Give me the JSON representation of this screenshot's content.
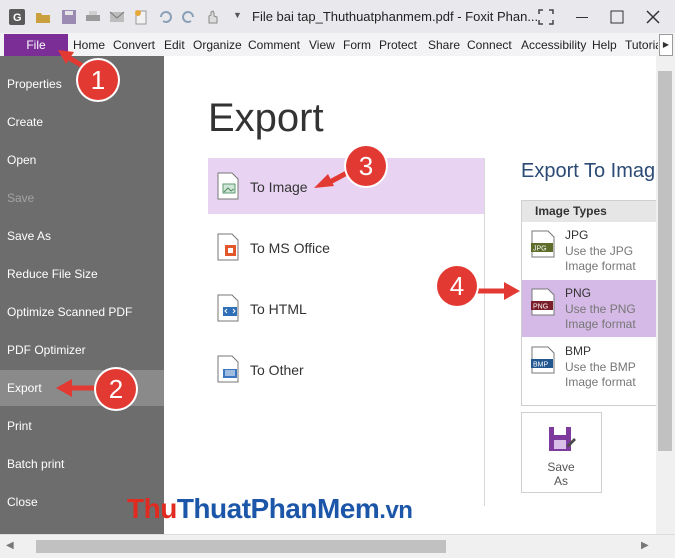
{
  "window": {
    "title": "File bai tap_Thuthuatphanmem.pdf - Foxit Phan..."
  },
  "ribbon": {
    "file_label": "File",
    "tabs": [
      "Home",
      "Convert",
      "Edit",
      "Organize",
      "Comment",
      "View",
      "Form",
      "Protect",
      "Share",
      "Connect",
      "Accessibility",
      "Help",
      "Tutoria"
    ]
  },
  "sidebar": {
    "items": [
      {
        "label": "Properties"
      },
      {
        "label": "Create"
      },
      {
        "label": "Open"
      },
      {
        "label": "Save"
      },
      {
        "label": "Save As"
      },
      {
        "label": "Reduce File Size"
      },
      {
        "label": "Optimize Scanned PDF"
      },
      {
        "label": "PDF Optimizer"
      },
      {
        "label": "Export"
      },
      {
        "label": "Print"
      },
      {
        "label": "Batch print"
      },
      {
        "label": "Close"
      }
    ]
  },
  "main": {
    "heading": "Export",
    "options": [
      {
        "label": "To Image"
      },
      {
        "label": "To MS Office"
      },
      {
        "label": "To HTML"
      },
      {
        "label": "To Other"
      }
    ],
    "export_to_heading": "Export To Imag",
    "image_types": {
      "header": "Image Types",
      "items": [
        {
          "name": "JPG",
          "badge": "JPG",
          "description": "Use the JPG Image format"
        },
        {
          "name": "PNG",
          "badge": "PNG",
          "description": "Use the PNG Image format"
        },
        {
          "name": "BMP",
          "badge": "BMP",
          "description": "Use the BMP Image format"
        }
      ]
    },
    "save_as": "Save As"
  },
  "callouts": [
    "1",
    "2",
    "3",
    "4"
  ],
  "watermark": {
    "part1": "Thu",
    "part2": "ThuatPhanMem",
    "part3": ".vn"
  },
  "colors": {
    "accent_purple": "#7b2e96",
    "selected_option": "#e8d3f3",
    "selected_type": "#d5b9e6",
    "sidebar_bg": "#6d6d6d",
    "callout_red": "#e23a33"
  }
}
